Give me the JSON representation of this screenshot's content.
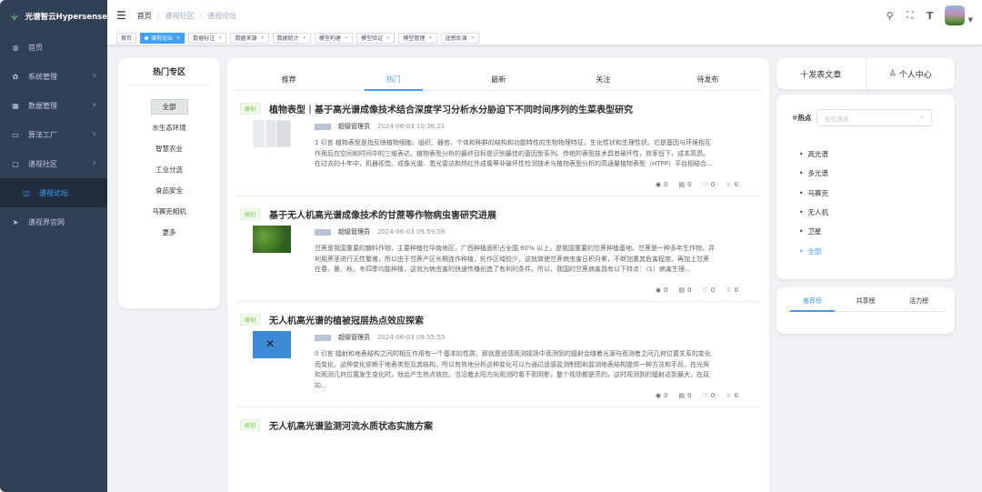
{
  "app": {
    "title": "光谱智云Hypersense"
  },
  "sidebar": {
    "items": [
      {
        "label": "首页",
        "icon": "dashboard-icon"
      },
      {
        "label": "系统管理",
        "icon": "gear-icon",
        "expandable": true
      },
      {
        "label": "数据管理",
        "icon": "database-icon",
        "expandable": true
      },
      {
        "label": "算法工厂",
        "icon": "monitor-icon",
        "expandable": true
      },
      {
        "label": "谱视社区",
        "icon": "window-icon",
        "expandable": true,
        "expanded": true
      },
      {
        "label": "谱视论坛",
        "icon": "book-icon",
        "sub": true,
        "active": true
      },
      {
        "label": "谱视界官网",
        "icon": "send-icon"
      }
    ]
  },
  "breadcrumb": [
    "首页",
    "谱视社区",
    "谱视论坛"
  ],
  "tags": [
    {
      "label": "首页",
      "active": false,
      "closable": false
    },
    {
      "label": "谱视论坛",
      "active": true,
      "closable": true
    },
    {
      "label": "数据标注",
      "active": false,
      "closable": true
    },
    {
      "label": "数据来源",
      "active": false,
      "closable": true
    },
    {
      "label": "数据统计",
      "active": false,
      "closable": true
    },
    {
      "label": "模型构建",
      "active": false,
      "closable": true
    },
    {
      "label": "模型验证",
      "active": false,
      "closable": true
    },
    {
      "label": "模型管理",
      "active": false,
      "closable": true
    },
    {
      "label": "遥感反演",
      "active": false,
      "closable": true
    }
  ],
  "hot_zone": {
    "title": "热门专区",
    "items": [
      "全部",
      "水生态环境",
      "智慧农业",
      "工业分选",
      "食品安全",
      "马赛克相机",
      "更多"
    ],
    "active_index": 0
  },
  "feed_tabs": {
    "items": [
      "推荐",
      "热门",
      "最新",
      "关注",
      "待发布"
    ],
    "active_index": 1
  },
  "articles": [
    {
      "badge": "原创",
      "title": "植物表型｜基于高光谱成像技术结合深度学习分析水分胁迫下不同时间序列的生菜表型研究",
      "author": "超级管理员",
      "time": "2024-06-03 10:38:21",
      "summary": "1 引言 植物表型是指反映植物细胞、组织、器官、个体和种群的结构和功能特性的生物物理特征，生化性状和生理性状。它是基因与环境相互作用后在空间和时间中的三维表达。植物表型分析的最终目标是识别最佳的基因型系列。传统的表型技术具有破坏性，效率低下，成本高昂。在过去的十年中，机器视觉、成像光谱、激光雷达和热红外成像等非破坏性检测技术与植物表型分析的高通量植物表型（HTPP）平台相结合...",
      "views": "0",
      "comments": "0",
      "likes": "0",
      "stars": "0"
    },
    {
      "badge": "原创",
      "title": "基于无人机高光谱成像技术的甘蔗等作物病虫害研究进展",
      "author": "超级管理员",
      "time": "2024-06-03 09:59:08",
      "summary": "甘蔗是我国重要的糖料作物，主要种植在华南地区，广西种植面积占全国 60% 以上，是我国重要的甘蔗种植基地。甘蔗是一种多年生作物，并利用蔗茎进行无性繁殖，所以由于甘蔗产区长期连作种植，轮作区域较少，这就致使甘蔗病虫害日积月累，不断加重其危害程度。再加上甘蔗在春、夏、秋、冬四季均能种植，这就为病虫害的快速传播创造了有利的条件。所以，我国的甘蔗病害具有以下特点：（1）病害生理...",
      "views": "0",
      "comments": "0",
      "likes": "0",
      "stars": "0"
    },
    {
      "badge": "原创",
      "title": "无人机高光谱的植被冠层热点效应探索",
      "author": "超级管理员",
      "time": "2024-06-03 09:55:55",
      "summary": "0 引言 辐射和地表结构之间的相互作用有一个基本的性质，那就是遥感观测视场中观测到的辐射会随着光源与观测者之间几何位置关系的变化而变化。这种变化依赖于地表类型及其结构，所以有效地分析这种变化可以为通过遥感监测制图和监测地表结构提供一种方法和手段。在光照和观测几何位置发生变化时，就会产生热点效应。当沿着太阳方向观测时看不到阴影，整个视场都是亮的，这时观测到的辐射达到最大，在双向...",
      "views": "0",
      "comments": "0",
      "likes": "0",
      "stars": "0"
    },
    {
      "badge": "原创",
      "title": "无人机高光谱监测河流水质状态实施方案"
    }
  ],
  "actions": {
    "publish": "十发表文章",
    "profile": "个人中心"
  },
  "hotspot": {
    "label": "热点",
    "placeholder": "标签筛选",
    "items": [
      "高光谱",
      "多光谱",
      "马赛克",
      "无人机",
      "卫星",
      "全部"
    ],
    "active_index": 5
  },
  "rank_tabs": {
    "items": [
      "推荐榜",
      "共享榜",
      "活力榜"
    ],
    "active_index": 0
  },
  "colors": {
    "primary": "#409eff",
    "sidebar_bg": "#304156",
    "badge_green": "#67c23a"
  }
}
